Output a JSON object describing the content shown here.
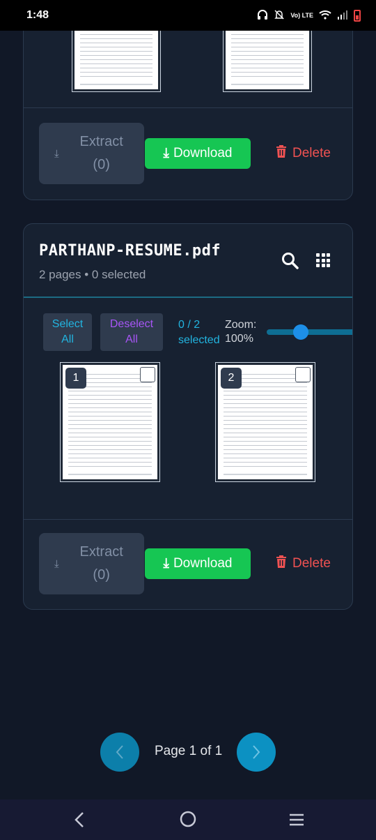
{
  "status_bar": {
    "time": "1:48",
    "network": "Vo) LTE"
  },
  "top_card": {
    "actions": {
      "extract_label": "Extract",
      "extract_count": "(0)",
      "download_label": "Download",
      "delete_label": "Delete"
    }
  },
  "file_card": {
    "file_name": "PARTHANP-RESUME.pdf",
    "meta": "2 pages • 0 selected",
    "toolbar": {
      "select_line1": "Select",
      "select_line2": "All",
      "deselect_line1": "Deselect",
      "deselect_line2": "All",
      "selected_count": "0 / 2",
      "selected_label": "selected",
      "zoom_label": "Zoom:",
      "zoom_value": "100%",
      "zoom_level": 0.35
    },
    "pages": [
      {
        "number": "1",
        "selected": false
      },
      {
        "number": "2",
        "selected": false
      }
    ],
    "actions": {
      "extract_label": "Extract",
      "extract_count": "(0)",
      "download_label": "Download",
      "delete_label": "Delete"
    }
  },
  "pagination": {
    "label": "Page 1 of 1"
  },
  "colors": {
    "accent_blue": "#0c91c2",
    "download_green": "#16c653",
    "delete_red": "#f05252",
    "select_blue": "#22b4e0",
    "deselect_purple": "#a855f7"
  },
  "icons": [
    "download-icon",
    "trash-icon",
    "search-icon",
    "grid-icon",
    "chevron-left-icon",
    "chevron-right-icon",
    "back-icon",
    "home-icon",
    "recents-icon"
  ]
}
